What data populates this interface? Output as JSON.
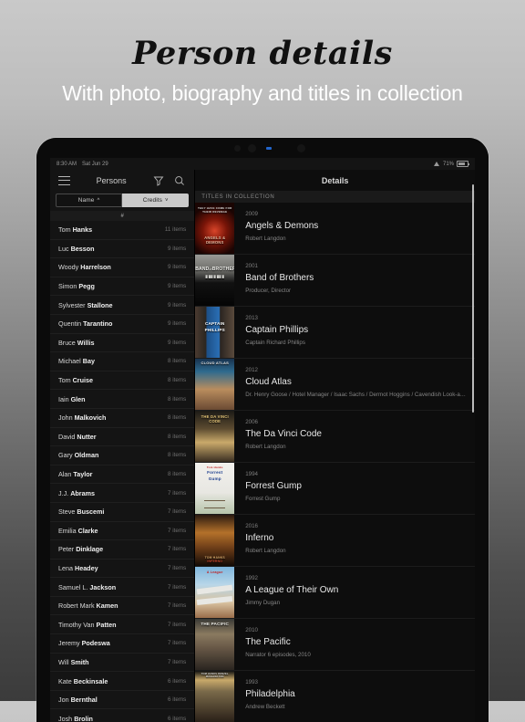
{
  "promo": {
    "title": "Person details",
    "subtitle": "With photo, biography and titles in collection"
  },
  "colors": {
    "bg_top": "#c9c9c9",
    "bg_bottom": "#3b3b3b",
    "screen_bg": "#0a0a0a",
    "left_pane_bg": "#141414",
    "right_pane_bg": "#0d0d0d",
    "accent_segment": "#c9c9c9",
    "text_primary": "#e8e8e8",
    "text_secondary": "#848484"
  },
  "statusbar": {
    "time": "8:30 AM",
    "date": "Sat Jun 29",
    "wifi_icon": "wifi-icon",
    "battery_percent": "71%",
    "battery_icon": "battery-icon"
  },
  "left_pane": {
    "menu_icon": "hamburger-menu-icon",
    "title": "Persons",
    "filter_icon": "filter-funnel-icon",
    "search_icon": "search-icon",
    "segments": [
      {
        "label": "Name",
        "caret": "^",
        "selected": true
      },
      {
        "label": "Credits",
        "caret": "˅",
        "selected": false
      }
    ],
    "index_label": "#",
    "people": [
      {
        "first": "Tom ",
        "last": "Hanks",
        "count": "11 items"
      },
      {
        "first": "Luc ",
        "last": "Besson",
        "count": "9 items"
      },
      {
        "first": "Woody ",
        "last": "Harrelson",
        "count": "9 items"
      },
      {
        "first": "Simon ",
        "last": "Pegg",
        "count": "9 items"
      },
      {
        "first": "Sylvester ",
        "last": "Stallone",
        "count": "9 items"
      },
      {
        "first": "Quentin ",
        "last": "Tarantino",
        "count": "9 items"
      },
      {
        "first": "Bruce ",
        "last": "Willis",
        "count": "9 items"
      },
      {
        "first": "Michael ",
        "last": "Bay",
        "count": "8 items"
      },
      {
        "first": "Tom ",
        "last": "Cruise",
        "count": "8 items"
      },
      {
        "first": "Iain ",
        "last": "Glen",
        "count": "8 items"
      },
      {
        "first": "John ",
        "last": "Malkovich",
        "count": "8 items"
      },
      {
        "first": "David ",
        "last": "Nutter",
        "count": "8 items"
      },
      {
        "first": "Gary ",
        "last": "Oldman",
        "count": "8 items"
      },
      {
        "first": "Alan ",
        "last": "Taylor",
        "count": "8 items"
      },
      {
        "first": "J.J. ",
        "last": "Abrams",
        "count": "7 items"
      },
      {
        "first": "Steve ",
        "last": "Buscemi",
        "count": "7 items"
      },
      {
        "first": "Emilia ",
        "last": "Clarke",
        "count": "7 items"
      },
      {
        "first": "Peter ",
        "last": "Dinklage",
        "count": "7 items"
      },
      {
        "first": "Lena ",
        "last": "Headey",
        "count": "7 items"
      },
      {
        "first": "Samuel L. ",
        "last": "Jackson",
        "count": "7 items"
      },
      {
        "first": "Robert Mark ",
        "last": "Kamen",
        "count": "7 items"
      },
      {
        "first": "Timothy Van ",
        "last": "Patten",
        "count": "7 items"
      },
      {
        "first": "Jeremy ",
        "last": "Podeswa",
        "count": "7 items"
      },
      {
        "first": "Will ",
        "last": "Smith",
        "count": "7 items"
      },
      {
        "first": "Kate ",
        "last": "Beckinsale",
        "count": "6 items"
      },
      {
        "first": "Jon ",
        "last": "Bernthal",
        "count": "6 items"
      },
      {
        "first": "Josh ",
        "last": "Brolin",
        "count": "6 items"
      }
    ]
  },
  "right_pane": {
    "title": "Details",
    "section_header": "TITLES IN COLLECTION",
    "titles": [
      {
        "year": "2009",
        "title": "Angels & Demons",
        "role": "Robert Langdon",
        "poster": "angels-and-demons-poster"
      },
      {
        "year": "2001",
        "title": "Band of Brothers",
        "role": "Producer, Director",
        "poster": "band-of-brothers-poster"
      },
      {
        "year": "2013",
        "title": "Captain Phillips",
        "role": "Captain Richard Phillips",
        "poster": "captain-phillips-poster"
      },
      {
        "year": "2012",
        "title": "Cloud Atlas",
        "role": "Dr. Henry Goose / Hotel Manager / Isaac Sachs / Dermot Hoggins / Cavendish Look-a…",
        "poster": "cloud-atlas-poster"
      },
      {
        "year": "2006",
        "title": "The Da Vinci Code",
        "role": "Robert Langdon",
        "poster": "da-vinci-code-poster"
      },
      {
        "year": "1994",
        "title": "Forrest Gump",
        "role": "Forrest Gump",
        "poster": "forrest-gump-poster"
      },
      {
        "year": "2016",
        "title": "Inferno",
        "role": "Robert Langdon",
        "poster": "inferno-poster"
      },
      {
        "year": "1992",
        "title": "A League of Their Own",
        "role": "Jimmy Dugan",
        "poster": "a-league-of-their-own-poster"
      },
      {
        "year": "2010",
        "title": "The Pacific",
        "role": "Narrator 6 episodes, 2010",
        "poster": "the-pacific-poster"
      },
      {
        "year": "1993",
        "title": "Philadelphia",
        "role": "Andrew Beckett",
        "poster": "philadelphia-poster"
      }
    ]
  }
}
